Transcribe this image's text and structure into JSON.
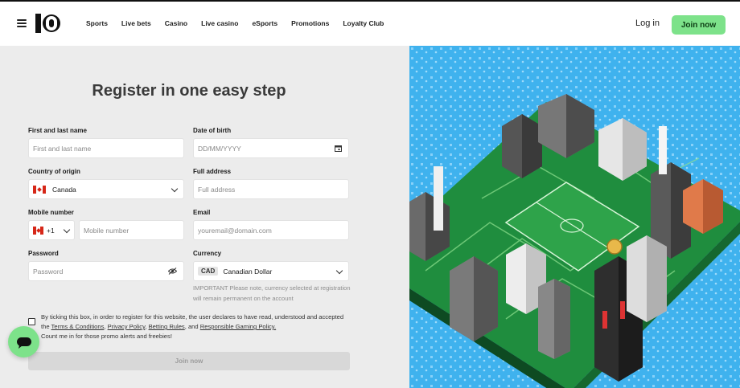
{
  "header": {
    "nav": [
      "Sports",
      "Live bets",
      "Casino",
      "Live casino",
      "eSports",
      "Promotions",
      "Loyalty Club"
    ],
    "login_label": "Log in",
    "join_label": "Join now"
  },
  "form": {
    "title": "Register in one easy step",
    "name": {
      "label": "First and last name",
      "placeholder": "First and last name"
    },
    "dob": {
      "label": "Date of birth",
      "placeholder": "DD/MM/YYYY"
    },
    "country": {
      "label": "Country of origin",
      "value": "Canada"
    },
    "address": {
      "label": "Full address",
      "placeholder": "Full address"
    },
    "mobile": {
      "label": "Mobile number",
      "code": "+1",
      "placeholder": "Mobile number"
    },
    "email": {
      "label": "Email",
      "placeholder": "youremail@domain.com"
    },
    "password": {
      "label": "Password",
      "placeholder": "Password"
    },
    "currency": {
      "label": "Currency",
      "code": "CAD",
      "value": "Canadian Dollar"
    },
    "currency_note": "IMPORTANT Please note, currency selected at registration will remain permanent on the account",
    "terms": {
      "text1": "By ticking this box, in order to register for this website, the user declares to have read, understood and accepted the",
      "link_terms": "Terms & Conditions",
      "link_privacy": "Privacy Policy",
      "link_betting": "Betting Rules",
      "and": ", and",
      "link_responsible": "Responsible Gaming Policy.",
      "text2": "Count me in for those promo alerts and freebies!"
    },
    "submit_label": "Join now"
  },
  "colors": {
    "accent": "#7de28a",
    "art_bg": "#3fb2ee",
    "panel_bg": "#ececec"
  }
}
